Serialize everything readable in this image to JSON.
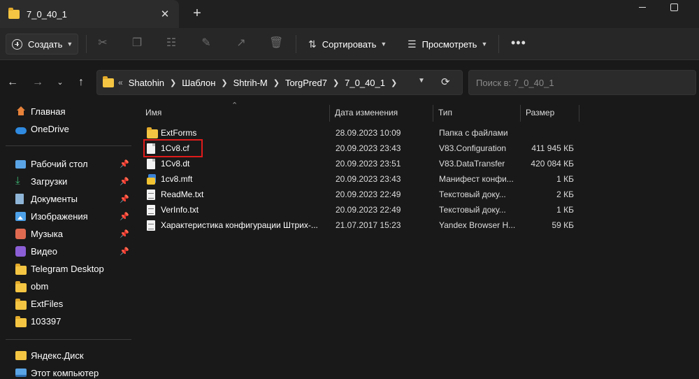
{
  "window": {
    "tab_title": "7_0_40_1",
    "tab_close": "✕",
    "new_tab": "+"
  },
  "toolbar": {
    "create_label": "Создать",
    "sort_label": "Сортировать",
    "view_label": "Просмотреть",
    "more_label": "•••",
    "icons": [
      "cut-icon",
      "copy-icon",
      "paste-icon",
      "rename-icon",
      "share-icon",
      "delete-icon"
    ]
  },
  "address": {
    "overflow": "«",
    "crumbs": [
      "Shatohin",
      "Шаблон",
      "Shtrih-M",
      "TorgPred7",
      "7_0_40_1"
    ],
    "search_placeholder": "Поиск в: 7_0_40_1"
  },
  "sidebar": {
    "top": [
      {
        "label": "Главная",
        "icon": "home-icon"
      },
      {
        "label": "OneDrive",
        "icon": "onedrive-icon"
      }
    ],
    "quick": [
      {
        "label": "Рабочий стол",
        "icon": "desktop-icon",
        "pinned": true
      },
      {
        "label": "Загрузки",
        "icon": "downloads-icon",
        "pinned": true
      },
      {
        "label": "Документы",
        "icon": "documents-icon",
        "pinned": true
      },
      {
        "label": "Изображения",
        "icon": "pictures-icon",
        "pinned": true
      },
      {
        "label": "Музыка",
        "icon": "music-icon",
        "pinned": true
      },
      {
        "label": "Видео",
        "icon": "video-icon",
        "pinned": true
      },
      {
        "label": "Telegram Desktop",
        "icon": "folder-icon",
        "pinned": false
      },
      {
        "label": "obm",
        "icon": "folder-icon",
        "pinned": false
      },
      {
        "label": "ExtFiles",
        "icon": "folder-icon",
        "pinned": false
      },
      {
        "label": "103397",
        "icon": "folder-icon",
        "pinned": false
      }
    ],
    "bottom": [
      {
        "label": "Яндекс.Диск",
        "icon": "yandex-disk-icon"
      },
      {
        "label": "Этот компьютер",
        "icon": "this-pc-icon"
      }
    ]
  },
  "columns": {
    "name": "Имя",
    "date": "Дата изменения",
    "type": "Тип",
    "size": "Размер"
  },
  "files": [
    {
      "name": "ExtForms",
      "date": "28.09.2023 10:09",
      "type": "Папка с файлами",
      "size": "",
      "icon": "folder-icon"
    },
    {
      "name": "1Cv8.cf",
      "date": "20.09.2023 23:43",
      "type": "V83.Configuration",
      "size": "411 945 КБ",
      "icon": "file-icon"
    },
    {
      "name": "1Cv8.dt",
      "date": "20.09.2023 23:51",
      "type": "V83.DataTransfer",
      "size": "420 084 КБ",
      "icon": "file-icon"
    },
    {
      "name": "1cv8.mft",
      "date": "20.09.2023 23:43",
      "type": "Манифест конфи...",
      "size": "1 КБ",
      "icon": "manifest-icon"
    },
    {
      "name": "ReadMe.txt",
      "date": "20.09.2023 22:49",
      "type": "Текстовый доку...",
      "size": "2 КБ",
      "icon": "text-file-icon"
    },
    {
      "name": "VerInfo.txt",
      "date": "20.09.2023 22:49",
      "type": "Текстовый доку...",
      "size": "1 КБ",
      "icon": "text-file-icon"
    },
    {
      "name": "Характеристика конфигурации Штрих-...",
      "date": "21.07.2017 15:23",
      "type": "Yandex Browser H...",
      "size": "59 КБ",
      "icon": "html-file-icon"
    }
  ],
  "colors": {
    "background": "#191919",
    "highlight_box": "#e01b1b",
    "folder": "#f4c542"
  }
}
